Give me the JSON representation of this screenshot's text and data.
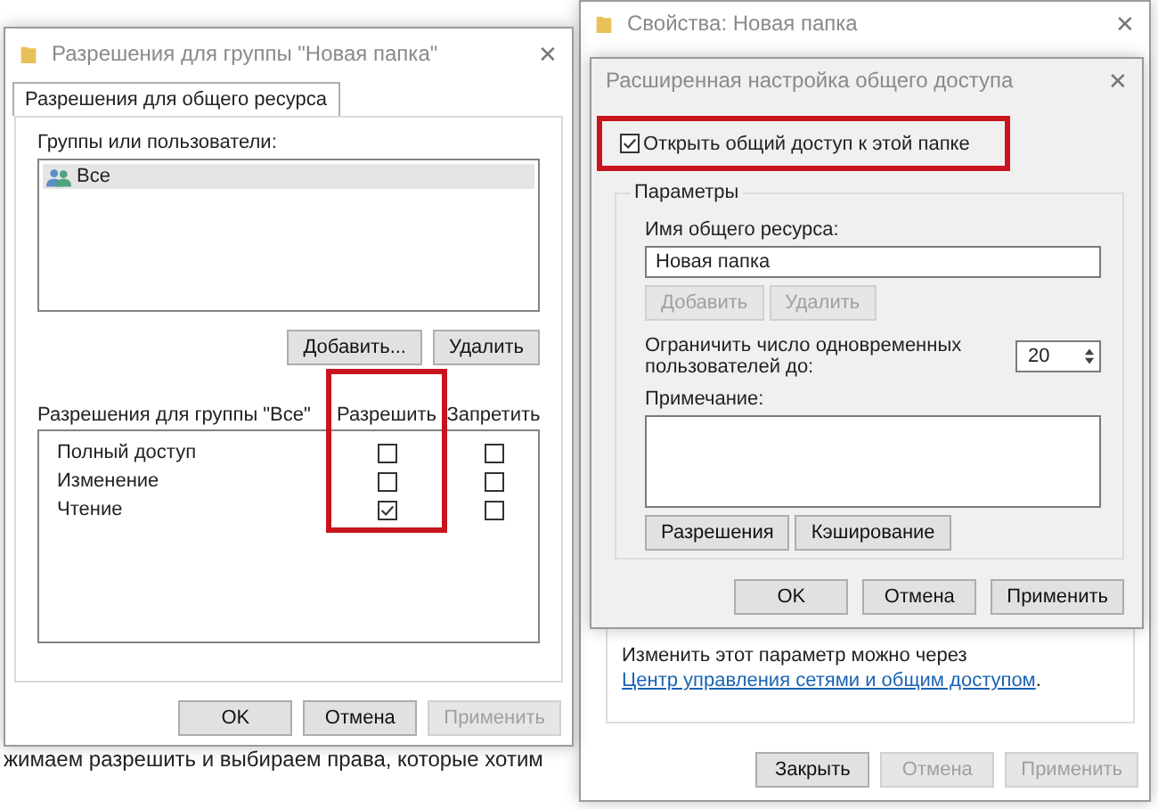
{
  "background_text": "жимаем разрешить и выбираем права, которые хотим",
  "permissions_window": {
    "title": "Разрешения для группы \"Новая папка\"",
    "close": "✕",
    "tabs": [
      {
        "label": "Разрешения для общего ресурса",
        "selected": true
      }
    ],
    "groups_label": "Группы или пользователи:",
    "users": [
      {
        "name": "Все",
        "selected": true
      }
    ],
    "user_buttons": [
      {
        "label": "Добавить...",
        "disabled": false
      },
      {
        "label": "Удалить",
        "disabled": false
      }
    ],
    "permissions_label": "Разрешения для группы \"Все\"",
    "columns": [
      {
        "label": "Разрешить",
        "highlighted": true
      },
      {
        "label": "Запретить",
        "highlighted": false
      }
    ],
    "permissions": [
      {
        "name": "Полный доступ",
        "allow": false,
        "deny": false
      },
      {
        "name": "Изменение",
        "allow": false,
        "deny": false
      },
      {
        "name": "Чтение",
        "allow": true,
        "deny": false
      }
    ],
    "footer_buttons": [
      {
        "label": "OK",
        "disabled": false
      },
      {
        "label": "Отмена",
        "disabled": false
      },
      {
        "label": "Применить",
        "disabled": true
      }
    ]
  },
  "properties_window": {
    "title": "Свойства: Новая папка",
    "close": "✕",
    "note_text": "Изменить этот параметр можно через",
    "note_link": "Центр управления сетями и общим доступом",
    "note_suffix": ".",
    "footer_buttons": [
      {
        "label": "Закрыть",
        "disabled": false
      },
      {
        "label": "Отмена",
        "disabled": true
      },
      {
        "label": "Применить",
        "disabled": true
      }
    ]
  },
  "advanced_dialog": {
    "title": "Расширенная настройка общего доступа",
    "close": "✕",
    "share": {
      "label": "Открыть общий доступ к этой папке",
      "checked": true,
      "highlighted": true
    },
    "group_title": "Параметры",
    "share_name_label": "Имя общего ресурса:",
    "share_name": "Новая папка",
    "name_buttons": [
      {
        "label": "Добавить",
        "disabled": true
      },
      {
        "label": "Удалить",
        "disabled": true
      }
    ],
    "limit_label": "Ограничить число одновременных пользователей до:",
    "limit_value": "20",
    "comment_label": "Примечание:",
    "buttons": [
      {
        "label": "Разрешения",
        "disabled": false
      },
      {
        "label": "Кэширование",
        "disabled": false
      }
    ],
    "footer_buttons": [
      {
        "label": "OK",
        "disabled": false
      },
      {
        "label": "Отмена",
        "disabled": false
      },
      {
        "label": "Применить",
        "disabled": false
      }
    ]
  }
}
